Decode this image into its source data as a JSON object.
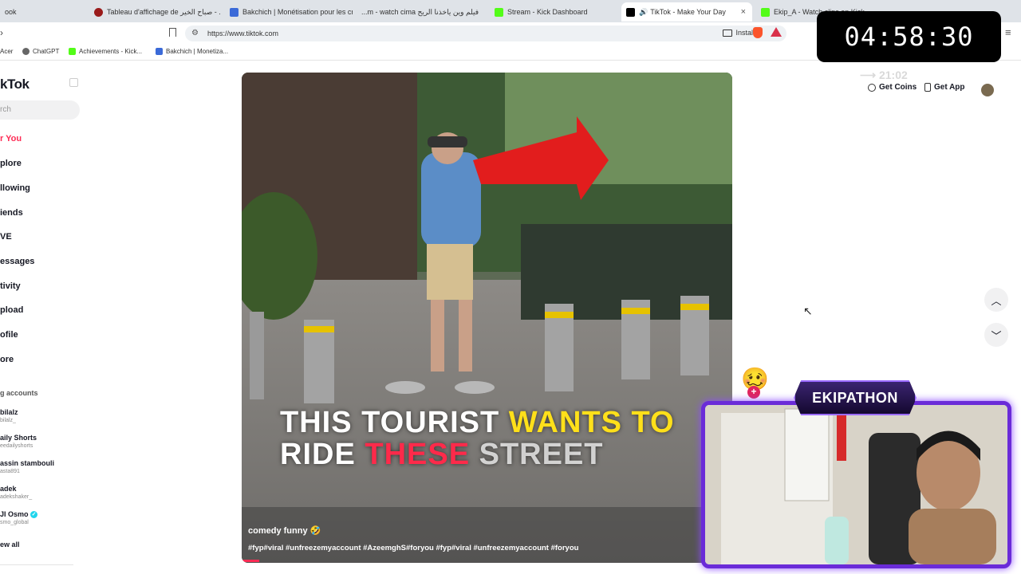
{
  "browser": {
    "tabs": [
      {
        "label": "ook",
        "fav_color": "#3b5998"
      },
      {
        "label": "Tableau d'affichage de صباح الخير - ...",
        "fav_color": "#9a1b1b"
      },
      {
        "label": "Bakchich | Monétisation pour les cr...",
        "fav_color": "#3b6ad8"
      },
      {
        "label": "...m - watch cima فيلم وين ياخذنا الريح",
        "fav_color": "#888888"
      },
      {
        "label": "Stream - Kick Dashboard",
        "fav_color": "#53fc18"
      },
      {
        "label": "TikTok - Make Your Day",
        "fav_color": "#000000"
      },
      {
        "label": "Ekip_A - Watch clips on Kick",
        "fav_color": "#53fc18"
      }
    ],
    "url": "https://www.tiktok.com",
    "install_label": "Install",
    "bookmarks": [
      {
        "label": "Acer",
        "fav_color": "#7a7a7a"
      },
      {
        "label": "ChatGPT",
        "fav_color": "#555555"
      },
      {
        "label": "Achievements - Kick...",
        "fav_color": "#53fc18"
      },
      {
        "label": "Bakchich | Monetiza...",
        "fav_color": "#3b6ad8"
      }
    ]
  },
  "tiktok": {
    "logo": "kTok",
    "search_placeholder": "rch",
    "nav": [
      {
        "label": "r You",
        "active": true
      },
      {
        "label": "plore"
      },
      {
        "label": "llowing"
      },
      {
        "label": "iends"
      },
      {
        "label": "VE"
      },
      {
        "label": "essages"
      },
      {
        "label": "tivity"
      },
      {
        "label": "pload"
      },
      {
        "label": "ofile"
      },
      {
        "label": "ore"
      }
    ],
    "following_header": "g accounts",
    "accounts": [
      {
        "name": "bilalz",
        "handle": "bilalz_"
      },
      {
        "name": "aily Shorts",
        "handle": "eedailyshorts"
      },
      {
        "name": "assin stambouli",
        "handle": "asta891"
      },
      {
        "name": "adek",
        "handle": "adekshaker_"
      },
      {
        "name": "JI Osmo",
        "handle": "smo_global",
        "verified": true
      }
    ],
    "see_all": "ew all",
    "header_buttons": {
      "coins": "Get Coins",
      "app": "Get App"
    },
    "video": {
      "caption_line1_white": "THIS TOURIST ",
      "caption_line1_yellow": "WANTS TO",
      "caption_line2_white": "RIDE ",
      "caption_line2_red": "THESE",
      "caption_line2_tail": " STREET",
      "author": "comedy funny",
      "hashtags": "#fyp#viral #unfreezemyaccount #AzeemghS#foryou #fyp#viral #unfreezemyaccount #foryou"
    }
  },
  "overlay": {
    "timer": "04:58:30",
    "timer_sub": "21:02",
    "stream_title": "EKIPATHON",
    "emoji": "🥴"
  }
}
